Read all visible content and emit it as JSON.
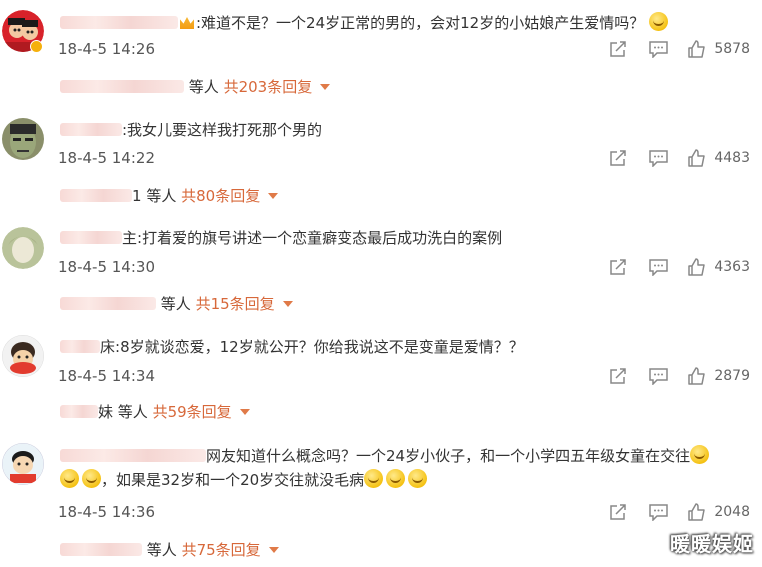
{
  "comments": [
    {
      "suffix": ":难道不是？一个24岁正常的男的，会对12岁的小姑娘产生爱情吗？",
      "timestamp": "18-4-5 14:26",
      "likes": "5878",
      "reply_prefix": "等人",
      "reply_count": "共203条回复"
    },
    {
      "suffix": ":我女儿要这样我打死那个男的",
      "timestamp": "18-4-5 14:22",
      "likes": "4483",
      "reply_visible": "1",
      "reply_prefix": "等人",
      "reply_count": "共80条回复"
    },
    {
      "name_visible": "主",
      "suffix": ":打着爱的旗号讲述一个恋童癖变态最后成功洗白的案例",
      "timestamp": "18-4-5 14:30",
      "likes": "4363",
      "reply_prefix": "等人",
      "reply_count": "共15条回复"
    },
    {
      "name_visible": "床",
      "suffix": ":8岁就谈恋爱，12岁就公开？你给我说这不是变童是爱情？？",
      "timestamp": "18-4-5 14:34",
      "likes": "2879",
      "reply_visible": "妹",
      "reply_prefix": "等人",
      "reply_count": "共59条回复"
    },
    {
      "name_visible": "网友知道什么概念吗？一个24岁小伙子，和一个小学四五年级女童在交往",
      "line2": "，如果是32岁和一个20岁交往就没毛病",
      "timestamp": "18-4-5 14:36",
      "likes": "2048",
      "reply_prefix": "等人",
      "reply_count": "共75条回复"
    }
  ],
  "watermark": "暖暖娱姬",
  "colors": {
    "reply_accent": "#d7683a",
    "icon_gray": "#888888"
  }
}
